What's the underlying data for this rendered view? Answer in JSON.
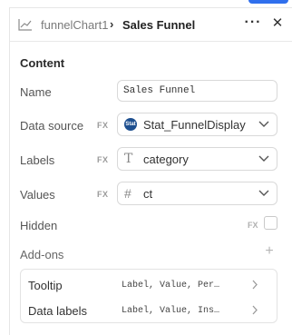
{
  "header": {
    "component_name": "funnelChart1",
    "separator": "›",
    "title": "Sales Funnel",
    "more_label": "···",
    "close_label": "✕",
    "icon": "line-chart-icon"
  },
  "content": {
    "section_title": "Content",
    "name": {
      "label": "Name",
      "value": "Sales Funnel"
    },
    "data_source": {
      "label": "Data source",
      "fx": "FX",
      "value": "Stat_FunnelDisplay",
      "badge": "Stat",
      "icon": "data-source-badge-icon"
    },
    "labels": {
      "label": "Labels",
      "fx": "FX",
      "value": "category",
      "icon": "text-type-icon",
      "icon_glyph": "T"
    },
    "values": {
      "label": "Values",
      "fx": "FX",
      "value": "ct",
      "icon": "number-type-icon",
      "icon_glyph": "#"
    },
    "hidden": {
      "label": "Hidden",
      "fx": "FX",
      "checked": false
    },
    "addons": {
      "label": "Add-ons",
      "add_glyph": "+",
      "items": [
        {
          "name": "Tooltip",
          "value": "Label, Value, Per…"
        },
        {
          "name": "Data labels",
          "value": "Label, Value, Ins…"
        }
      ]
    }
  },
  "colors": {
    "accent": "#2f6fed",
    "badge": "#1d4f8f",
    "border": "#d9d9d9"
  }
}
